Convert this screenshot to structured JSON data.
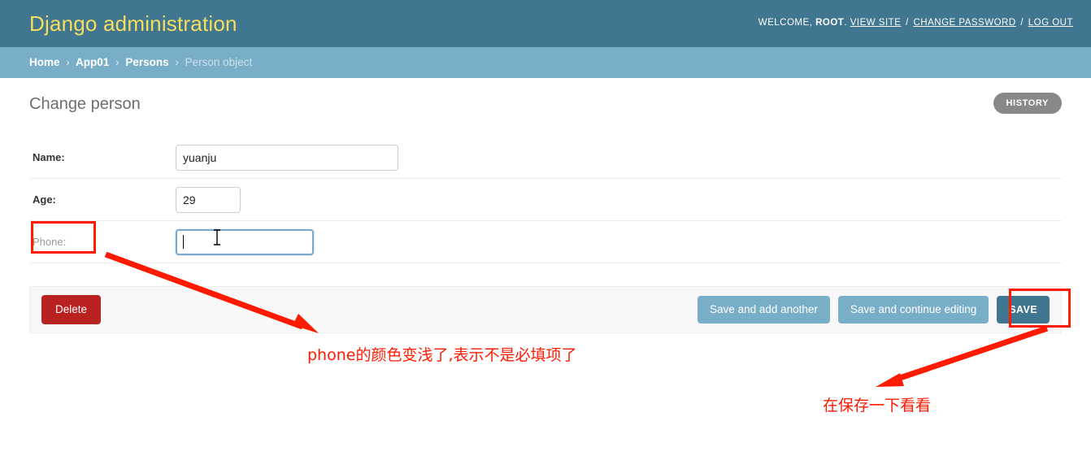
{
  "header": {
    "site_name": "Django administration",
    "user_tools": {
      "welcome_prefix": "WELCOME,",
      "username": "ROOT",
      "punctuation": ".",
      "view_site": "VIEW SITE",
      "separator": "/",
      "change_password": "CHANGE PASSWORD",
      "log_out": "LOG OUT"
    }
  },
  "breadcrumbs": {
    "items": [
      {
        "label": "Home",
        "current": false
      },
      {
        "label": "App01",
        "current": false
      },
      {
        "label": "Persons",
        "current": false
      },
      {
        "label": "Person object",
        "current": true
      }
    ],
    "separator": "›"
  },
  "content": {
    "title": "Change person",
    "history_label": "HISTORY"
  },
  "form": {
    "rows": [
      {
        "label": "Name:",
        "value": "yuanju",
        "required": true,
        "focused": false,
        "placeholder": ""
      },
      {
        "label": "Age:",
        "value": "29",
        "required": true,
        "focused": false,
        "placeholder": ""
      },
      {
        "label": "Phone:",
        "value": "",
        "required": false,
        "focused": true,
        "placeholder": ""
      }
    ]
  },
  "submit_row": {
    "delete_label": "Delete",
    "save_and_add_another_label": "Save and add another",
    "save_and_continue_label": "Save and continue editing",
    "save_label": "SAVE"
  },
  "annotations": {
    "note_1": "phone的颜色变浅了,表示不是必填项了",
    "note_2": "在保存一下看看",
    "highlight_color": "#ff1a00"
  },
  "colors": {
    "header_bg": "#417690",
    "breadcrumb_bg": "#79aec8",
    "site_name": "#f5dd5d",
    "delete_button": "#ba2121",
    "default_button": "#79aec8",
    "primary_button": "#417690",
    "history_button": "#888888",
    "focus_border": "#7aa7cc",
    "optional_label": "#999999"
  }
}
